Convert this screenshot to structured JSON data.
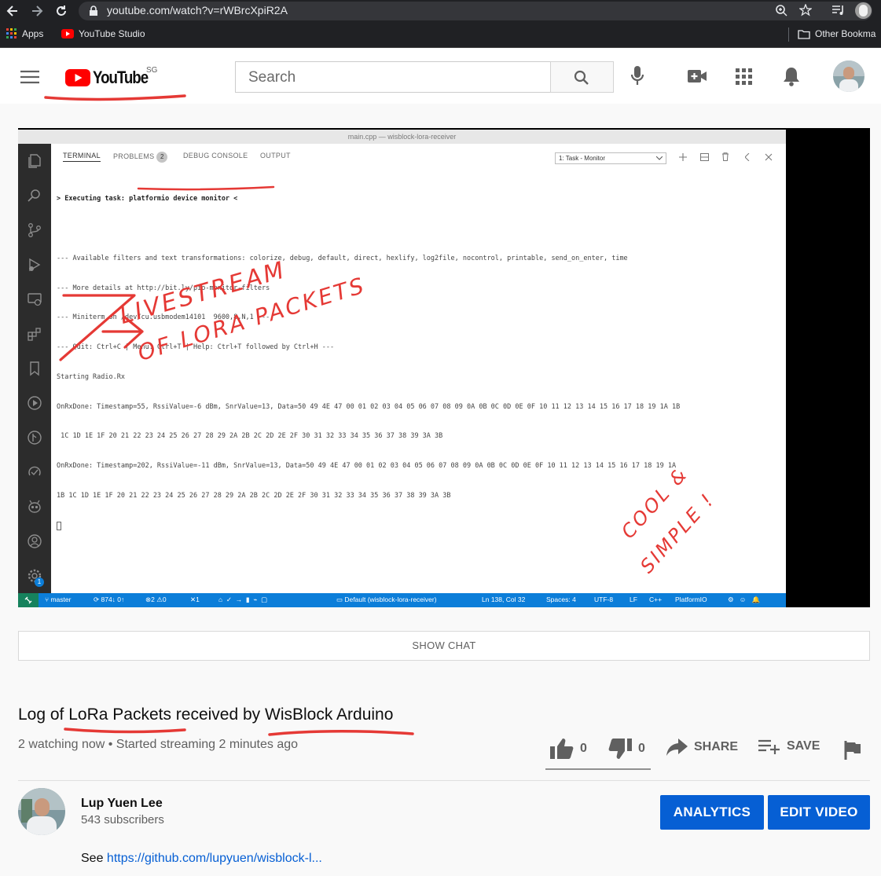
{
  "browser": {
    "url": "youtube.com/watch?v=rWBrcXpiR2A",
    "bookmarks": {
      "apps": "Apps",
      "studio": "YouTube Studio",
      "other": "Other Bookma"
    }
  },
  "header": {
    "logo_text": "YouTube",
    "region": "SG",
    "search_placeholder": "Search"
  },
  "vscode": {
    "window_title": "main.cpp — wisblock-lora-receiver",
    "tabs": [
      "TERMINAL",
      "PROBLEMS",
      "DEBUG CONSOLE",
      "OUTPUT"
    ],
    "problems_count": "2",
    "task_select": "1: Task - Monitor",
    "terminal_lines": [
      "> Executing task: platformio device monitor <",
      "",
      "--- Available filters and text transformations: colorize, debug, default, direct, hexlify, log2file, nocontrol, printable, send_on_enter, time",
      "--- More details at http://bit.ly/pio-monitor-filters",
      "--- Miniterm on /dev/cu.usbmodem14101  9600,8,N,1 ---",
      "--- Quit: Ctrl+C | Menu: Ctrl+T | Help: Ctrl+T followed by Ctrl+H ---",
      "Starting Radio.Rx",
      "OnRxDone: Timestamp=55, RssiValue=-6 dBm, SnrValue=13, Data=50 49 4E 47 00 01 02 03 04 05 06 07 08 09 0A 0B 0C 0D 0E 0F 10 11 12 13 14 15 16 17 18 19 1A 1B",
      " 1C 1D 1E 1F 20 21 22 23 24 25 26 27 28 29 2A 2B 2C 2D 2E 2F 30 31 32 33 34 35 36 37 38 39 3A 3B",
      "OnRxDone: Timestamp=202, RssiValue=-11 dBm, SnrValue=13, Data=50 49 4E 47 00 01 02 03 04 05 06 07 08 09 0A 0B 0C 0D 0E 0F 10 11 12 13 14 15 16 17 18 19 1A",
      "1B 1C 1D 1E 1F 20 21 22 23 24 25 26 27 28 29 2A 2B 2C 2D 2E 2F 30 31 32 33 34 35 36 37 38 39 3A 3B"
    ],
    "status": {
      "branch": "master",
      "sync": "874↓ 0↑",
      "errors": "⊗2 ⚠0",
      "tools": "✕1",
      "env": "Default (wisblock-lora-receiver)",
      "position": "Ln 138, Col 32",
      "spaces": "Spaces: 4",
      "encoding": "UTF-8",
      "eol": "LF",
      "lang": "C++",
      "platform": "PlatformIO",
      "ext_badge": "1"
    }
  },
  "annotations": {
    "line1": "LIVESTREAM",
    "line2": "OF LORA PACKETS",
    "side1": "COOL &",
    "side2": "SIMPLE !"
  },
  "show_chat": "SHOW CHAT",
  "video": {
    "title": "Log of LoRa Packets received by WisBlock Arduino",
    "meta": "2 watching now • Started streaming 2 minutes ago",
    "likes": "0",
    "dislikes": "0",
    "share": "SHARE",
    "save": "SAVE"
  },
  "channel": {
    "name": "Lup Yuen Lee",
    "subscribers": "543 subscribers",
    "analytics": "ANALYTICS",
    "edit": "EDIT VIDEO"
  },
  "description": {
    "prefix": "See ",
    "link": "https://github.com/lupyuen/wisblock-l..."
  },
  "colors": {
    "accent": "#065fd4",
    "yt_red": "#ff0000",
    "annotation": "#e53935",
    "vscode_status": "#0c7ed9"
  }
}
